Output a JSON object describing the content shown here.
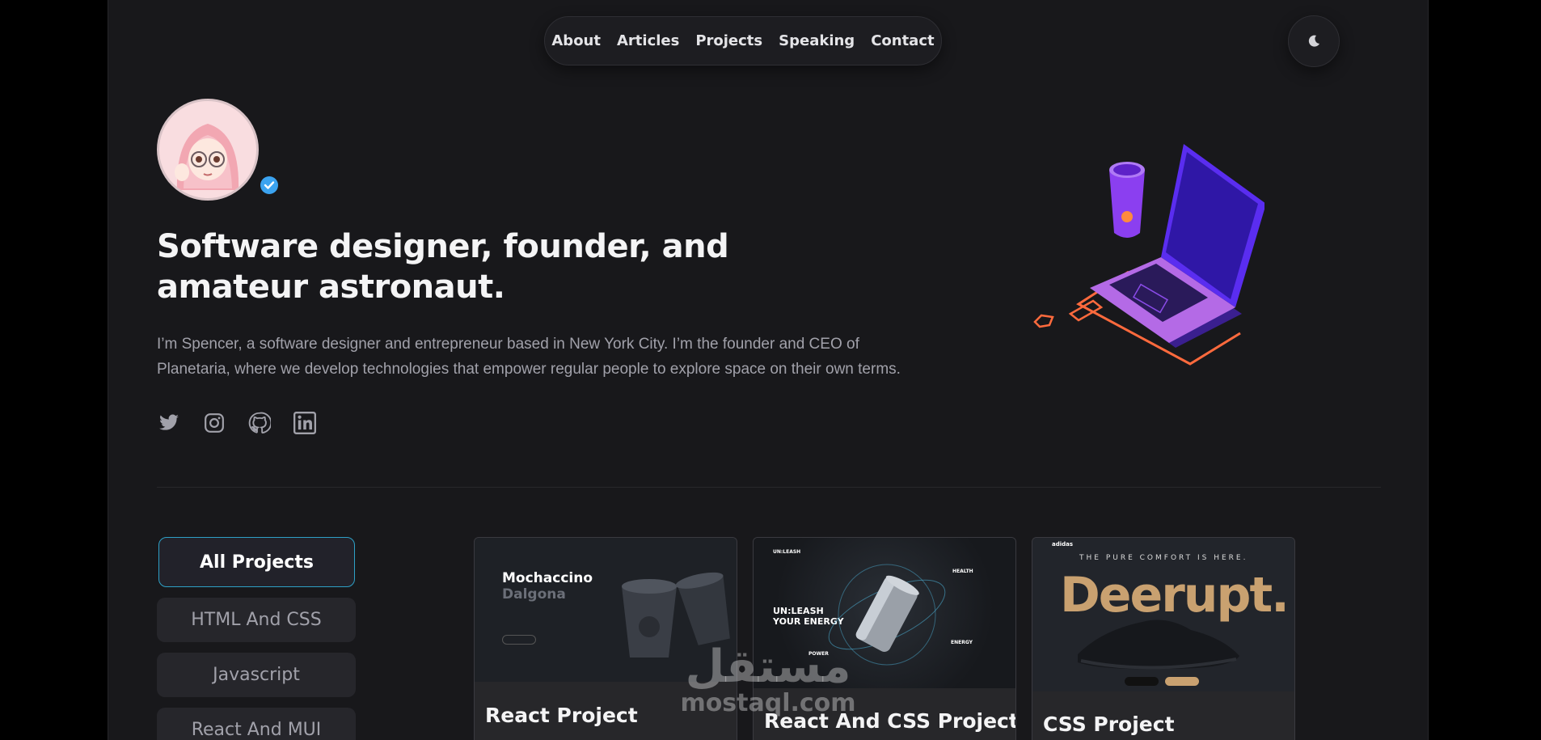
{
  "nav": {
    "items": [
      "About",
      "Articles",
      "Projects",
      "Speaking",
      "Contact"
    ]
  },
  "theme_toggle": {
    "icon": "moon-icon"
  },
  "hero": {
    "headline": "Software designer, founder, and amateur astronaut.",
    "bio": "I’m Spencer, a software designer and entrepreneur based in New York City. I’m the founder and CEO of Planetaria, where we develop technologies that empower regular people to explore space on their own terms.",
    "socials": [
      "twitter-icon",
      "instagram-icon",
      "github-icon",
      "linkedin-icon"
    ]
  },
  "filters": [
    "All Projects",
    "HTML And CSS",
    "Javascript",
    "React And MUI"
  ],
  "projects": [
    {
      "title": "React Project",
      "thumb_heading_1": "Mochaccino",
      "thumb_heading_2": "Dalgona"
    },
    {
      "title": "React And CSS Project",
      "thumb_brand": "UN:LEASH",
      "thumb_heading": "UN:LEASH YOUR ENERGY",
      "thumb_tag_1": "HEALTH",
      "thumb_tag_2": "POWER",
      "thumb_tag_3": "ENERGY"
    },
    {
      "title": "CSS Project",
      "thumb_brand": "adidas",
      "thumb_tagline": "THE PURE COMFORT IS HERE.",
      "thumb_heading": "Deerupt."
    }
  ],
  "watermark": {
    "arabic": "مستقل",
    "latin": "mostaql.com"
  },
  "colors": {
    "page_bg": "#18181b",
    "outer_bg": "#000000",
    "accent": "#2ea0c6",
    "verified": "#3ba3f0"
  }
}
